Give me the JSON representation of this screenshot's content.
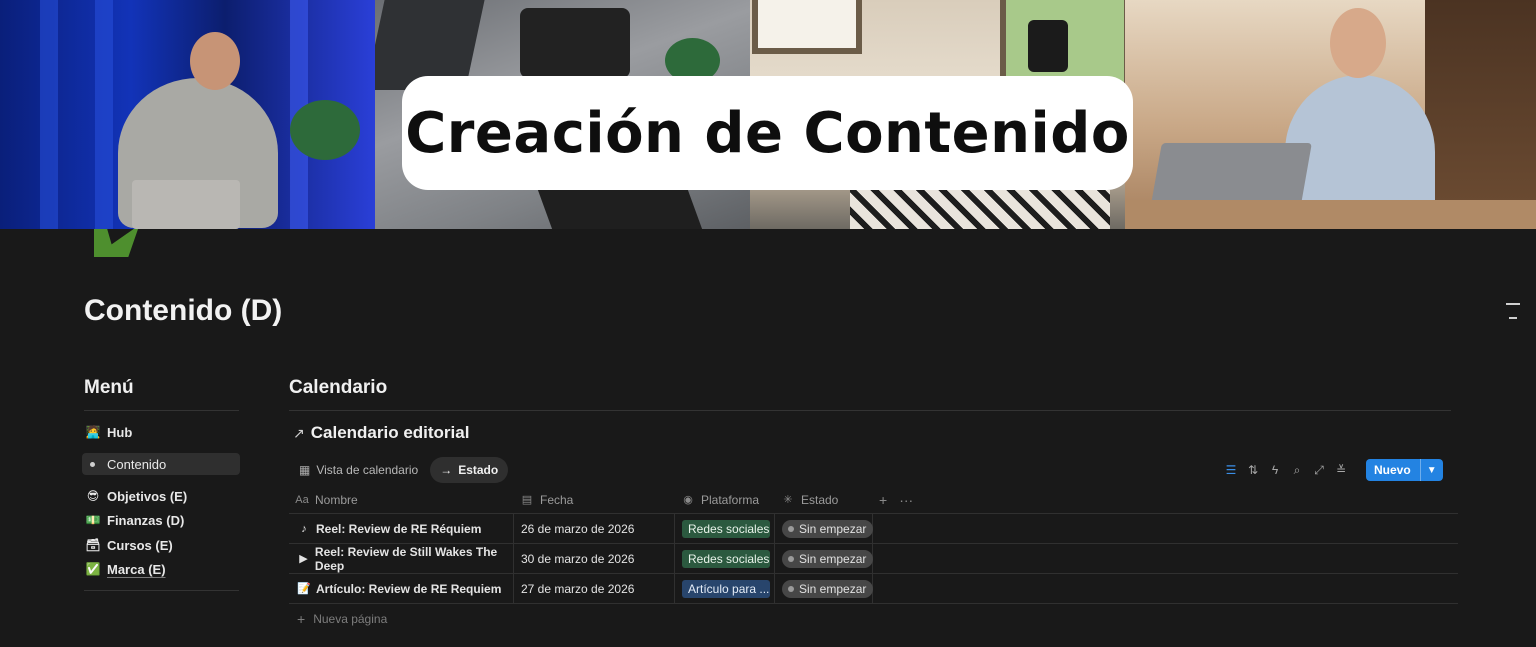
{
  "cover": {
    "title": "Creación de Contenido"
  },
  "page": {
    "title": "Contenido (D)"
  },
  "menu": {
    "title": "Menú",
    "items": [
      {
        "icon": "🧑‍💻",
        "label": "Hub"
      },
      {
        "icon": "",
        "label": "Contenido"
      },
      {
        "icon": "😎",
        "label": "Objetivos (E)"
      },
      {
        "icon": "💵",
        "label": "Finanzas (D)"
      },
      {
        "icon": "🗃",
        "label": "Cursos (E)"
      },
      {
        "icon": "✅",
        "label": "Marca (E)"
      }
    ]
  },
  "main": {
    "section_title": "Calendario",
    "database_title": "Calendario editorial",
    "views": [
      {
        "label": "Vista de calendario"
      },
      {
        "label": "Estado"
      }
    ],
    "new_button": "Nuevo",
    "columns": [
      {
        "icon": "Aa",
        "label": "Nombre"
      },
      {
        "icon": "📅",
        "label": "Fecha"
      },
      {
        "icon": "◉",
        "label": "Plataforma"
      },
      {
        "icon": "✳",
        "label": "Estado"
      }
    ],
    "rows": [
      {
        "icon": "♪",
        "name": "Reel: Review de RE Réquiem",
        "date": "26 de marzo de 2026",
        "platform": "Redes sociales",
        "status": "Sin empezar"
      },
      {
        "icon": "▶",
        "name": "Reel: Review de Still Wakes The Deep",
        "date": "30 de marzo de 2026",
        "platform": "Redes sociales",
        "status": "Sin empezar"
      },
      {
        "icon": "📝",
        "name": "Artículo: Review de RE Requiem",
        "date": "27 de marzo de 2026",
        "platform": "Artículo para ...",
        "status": "Sin empezar"
      }
    ],
    "new_page": "Nueva página"
  },
  "colors": {
    "background": "#191919",
    "accent": "#2383e2",
    "tag_green": "#2b593f",
    "tag_blue": "#28456c"
  }
}
